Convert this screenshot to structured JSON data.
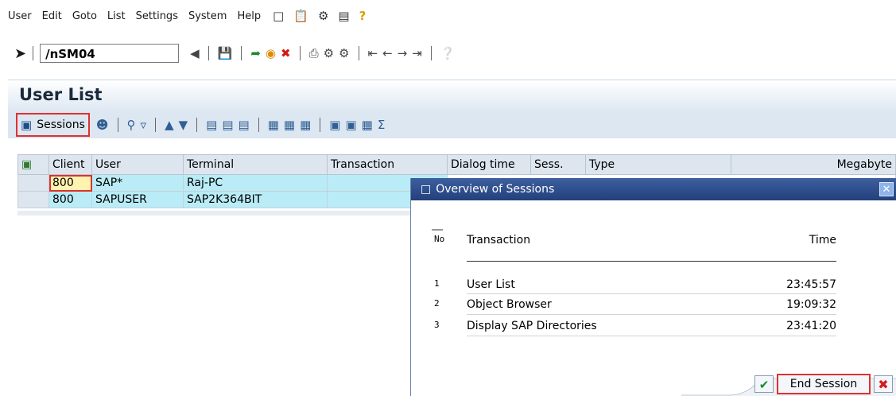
{
  "menubar": {
    "items": [
      "User",
      "Edit",
      "Goto",
      "List",
      "Settings",
      "System",
      "Help"
    ],
    "icons": [
      "new-document-icon",
      "clipboard-icon",
      "customize-layout-icon",
      "window-icon",
      "help-question-icon"
    ]
  },
  "command_field": {
    "value": "/nSM04"
  },
  "page_title": "User List",
  "app_toolbar": {
    "sessions_label": "Sessions"
  },
  "table": {
    "columns": [
      "Client",
      "User",
      "Terminal",
      "Transaction",
      "Dialog time",
      "Sess.",
      "Type",
      "Megabyte"
    ],
    "rows": [
      {
        "client": "800",
        "user": "SAP*",
        "terminal": "Raj-PC"
      },
      {
        "client": "800",
        "user": "SAPUSER",
        "terminal": "SAP2K364BIT"
      }
    ]
  },
  "dialog": {
    "title": "Overview of Sessions",
    "headers": {
      "no": "No",
      "transaction": "Transaction",
      "time": "Time"
    },
    "sessions": [
      {
        "no": "1",
        "transaction": "User List",
        "time": "23:45:57"
      },
      {
        "no": "2",
        "transaction": "Object Browser",
        "time": "19:09:32"
      },
      {
        "no": "3",
        "transaction": "Display SAP Directories",
        "time": "23:41:20"
      }
    ],
    "end_session_label": "End Session"
  },
  "colors": {
    "title_gradient_dark": "#23407a",
    "row_highlight": "#b9ecf6",
    "selected_cell": "#fff3b0",
    "focus_border": "#e03030"
  }
}
